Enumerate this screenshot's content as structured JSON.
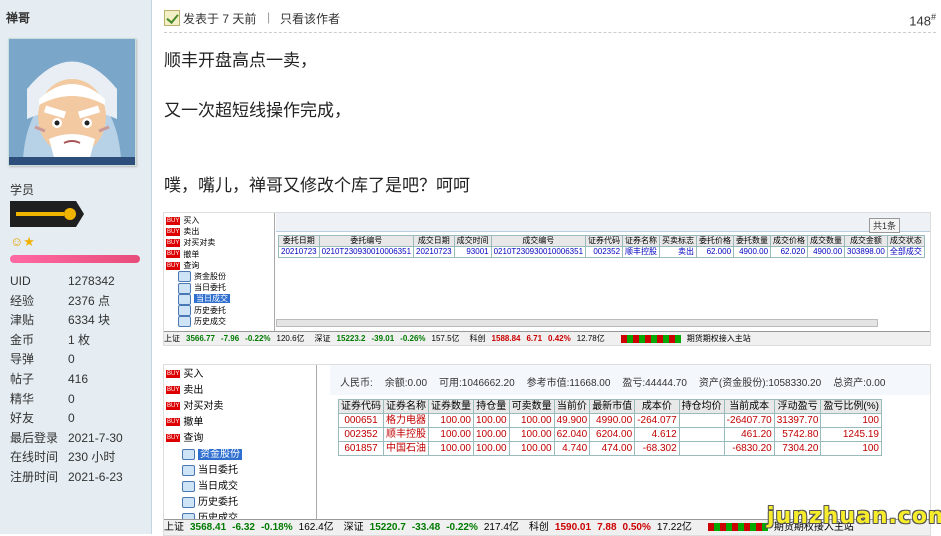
{
  "user": {
    "name": "禅哥",
    "group": "学员",
    "stats": [
      {
        "k": "UID",
        "v": "1278342"
      },
      {
        "k": "经验",
        "v": "2376 点"
      },
      {
        "k": "津贴",
        "v": "6334 块"
      },
      {
        "k": "金币",
        "v": "1 枚"
      },
      {
        "k": "导弹",
        "v": "0"
      },
      {
        "k": "帖子",
        "v": "416"
      },
      {
        "k": "精华",
        "v": "0"
      },
      {
        "k": "好友",
        "v": "0"
      },
      {
        "k": "最后登录",
        "v": "2021-7-30"
      },
      {
        "k": "在线时间",
        "v": "230 小时"
      },
      {
        "k": "注册时间",
        "v": "2021-6-23"
      }
    ]
  },
  "post": {
    "posted": "发表于 7 天前",
    "sep": "|",
    "author_only": "只看该作者",
    "floor": "148",
    "floor_sup": "#",
    "lines": [
      "顺丰开盘高点一卖，",
      "又一次超短线操作完成，",
      "噗，嘴儿，禅哥又修改个库了是吧？呵呵"
    ]
  },
  "shot1": {
    "tree": [
      "买入",
      "卖出",
      "对买对卖",
      "撤单",
      "查询",
      "资金股份",
      "当日委托",
      "当日成交",
      "历史委托",
      "历史成交"
    ],
    "badge": "共1条",
    "headers": [
      "委托日期",
      "委托编号",
      "成交日期",
      "成交时间",
      "成交编号",
      "证券代码",
      "证券名称",
      "买卖标志",
      "委托价格",
      "委托数量",
      "成交价格",
      "成交数量",
      "成交金额",
      "成交状态"
    ],
    "row": [
      "20210723",
      "0210T230930010006351",
      "20210723",
      "93001",
      "0210T230930010006351",
      "002352",
      "顺丰控股",
      "卖出",
      "62.000",
      "4900.00",
      "62.020",
      "4900.00",
      "303898.00",
      "全部成交"
    ],
    "status": {
      "sh_label": "上证",
      "sh": "3566.77",
      "sh_chg": "-7.96",
      "sh_pct": "-0.22%",
      "sh_vol": "120.6亿",
      "sz_label": "深证",
      "sz": "15223.2",
      "sz_chg": "-39.01",
      "sz_pct": "-0.26%",
      "sz_vol": "157.5亿",
      "cy_label": "科创",
      "cy": "1588.84",
      "cy_chg": "6.71",
      "cy_pct": "0.42%",
      "cy_vol": "12.78亿",
      "tail": "期货期权接入主站"
    }
  },
  "shot2": {
    "tree": [
      "买入",
      "卖出",
      "对买对卖",
      "撤单",
      "查询",
      "资金股份",
      "当日委托",
      "当日成交",
      "历史委托",
      "历史成交"
    ],
    "summary": {
      "rmb": "人民币:",
      "balance": "余额:0.00",
      "available": "可用:1046662.20",
      "ref_value": "参考市值:11668.00",
      "pnl": "盈亏:44444.70",
      "assets": "资产(资金股份):1058330.20",
      "total": "总资产:0.00"
    },
    "headers": [
      "证券代码",
      "证券名称",
      "证券数量",
      "持仓量",
      "可卖数量",
      "当前价",
      "最新市值",
      "成本价",
      "持仓均价",
      "当前成本",
      "浮动盈亏",
      "盈亏比例(%)"
    ],
    "rows": [
      [
        "000651",
        "格力电器",
        "100.00",
        "100.00",
        "100.00",
        "49.900",
        "4990.00",
        "-264.077",
        "",
        "-26407.70",
        "31397.70",
        "100"
      ],
      [
        "002352",
        "顺丰控股",
        "100.00",
        "100.00",
        "100.00",
        "62.040",
        "6204.00",
        "4.612",
        "",
        "461.20",
        "5742.80",
        "1245.19"
      ],
      [
        "601857",
        "中国石油",
        "100.00",
        "100.00",
        "100.00",
        "4.740",
        "474.00",
        "-68.302",
        "",
        "-6830.20",
        "7304.20",
        "100"
      ]
    ],
    "status": {
      "sh_label": "上证",
      "sh": "3568.41",
      "sh_chg": "-6.32",
      "sh_pct": "-0.18%",
      "sh_vol": "162.4亿",
      "sz_label": "深证",
      "sz": "15220.7",
      "sz_chg": "-33.48",
      "sz_pct": "-0.22%",
      "sz_vol": "217.4亿",
      "cy_label": "科创",
      "cy": "1590.01",
      "cy_chg": "7.88",
      "cy_pct": "0.50%",
      "cy_vol": "17.22亿",
      "tail": "期货期权接入主站"
    }
  },
  "watermark": "junzhuan.com"
}
